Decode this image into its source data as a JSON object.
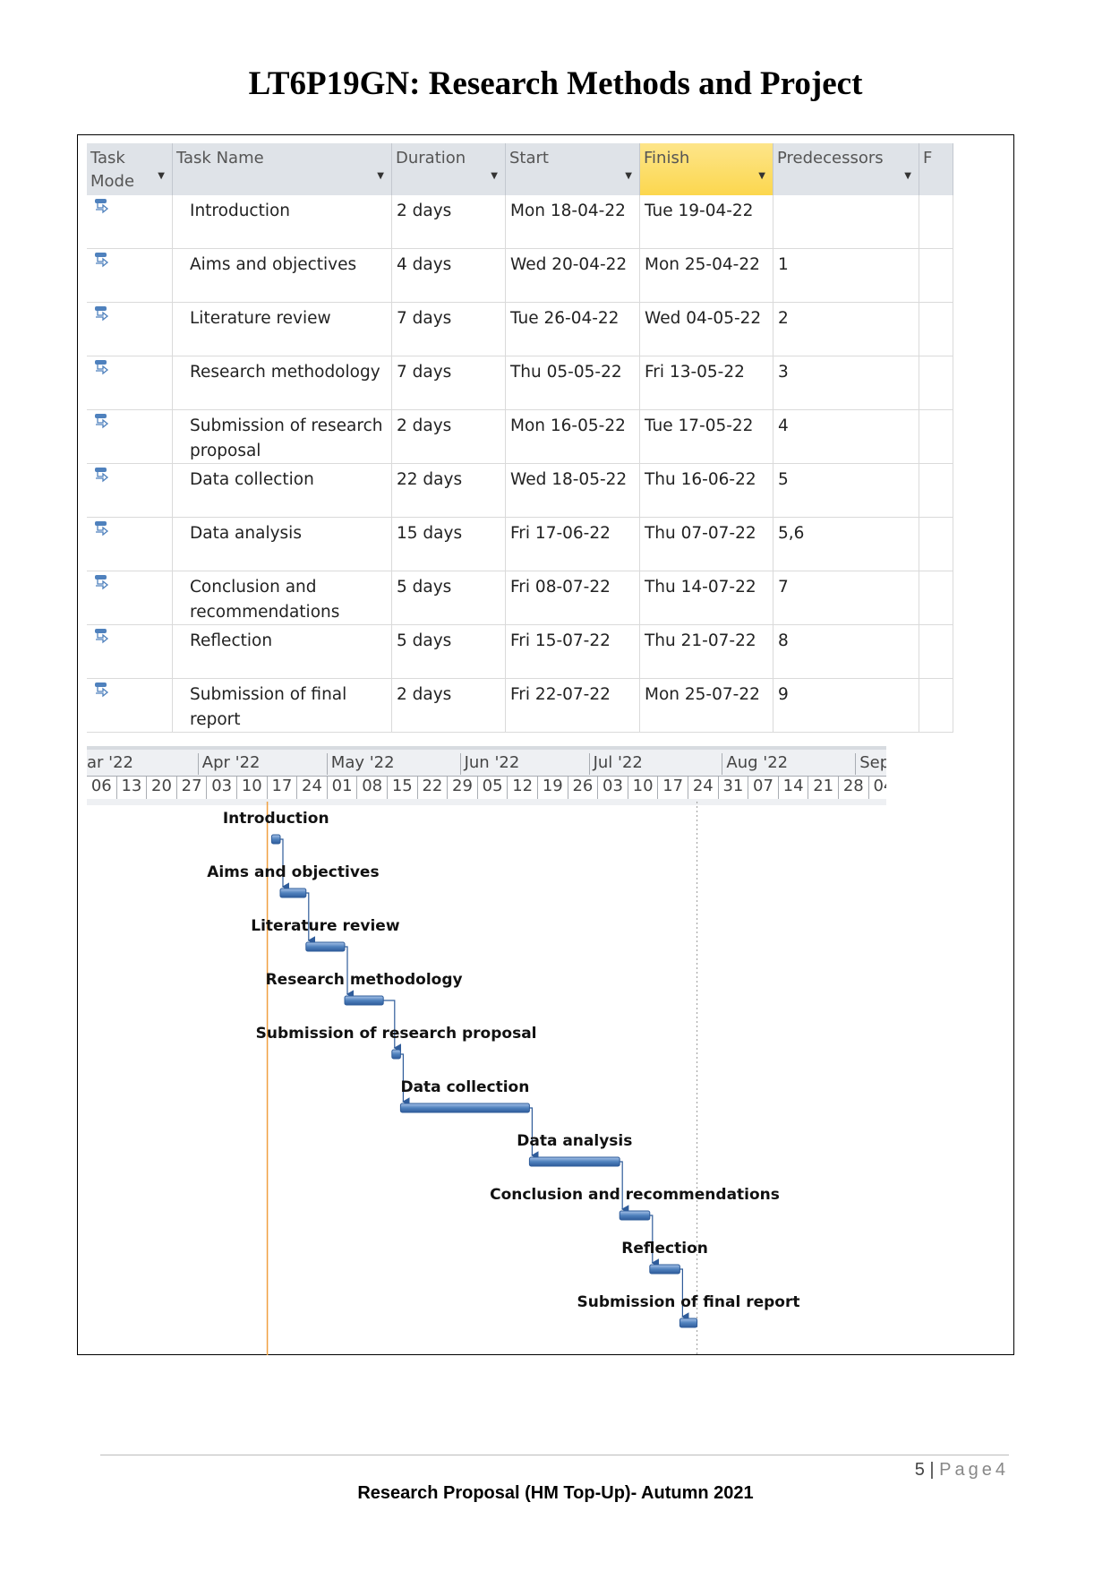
{
  "document_title": "LT6P19GN: Research Methods and Project",
  "table": {
    "headers": {
      "task_mode": "Task Mode",
      "task_name": "Task Name",
      "duration": "Duration",
      "start": "Start",
      "finish": "Finish",
      "predecessors": "Predecessors",
      "extra": "F"
    },
    "finish_header_color": "#fcd74e",
    "rows": [
      {
        "mode_icon": "auto-scheduled-task-icon",
        "name": "Introduction",
        "duration": "2 days",
        "start": "Mon 18-04-22",
        "finish": "Tue 19-04-22",
        "predecessors": ""
      },
      {
        "mode_icon": "auto-scheduled-task-icon",
        "name": "Aims and objectives",
        "duration": "4 days",
        "start": "Wed 20-04-22",
        "finish": "Mon 25-04-22",
        "predecessors": "1"
      },
      {
        "mode_icon": "auto-scheduled-task-icon",
        "name": "Literature review",
        "duration": "7 days",
        "start": "Tue 26-04-22",
        "finish": "Wed 04-05-22",
        "predecessors": "2"
      },
      {
        "mode_icon": "auto-scheduled-task-icon",
        "name": "Research methodology",
        "duration": "7 days",
        "start": "Thu 05-05-22",
        "finish": "Fri 13-05-22",
        "predecessors": "3"
      },
      {
        "mode_icon": "auto-scheduled-task-icon",
        "name": "Submission of research proposal",
        "duration": "2 days",
        "start": "Mon 16-05-22",
        "finish": "Tue 17-05-22",
        "predecessors": "4"
      },
      {
        "mode_icon": "auto-scheduled-task-icon",
        "name": "Data collection",
        "duration": "22 days",
        "start": "Wed 18-05-22",
        "finish": "Thu 16-06-22",
        "predecessors": "5"
      },
      {
        "mode_icon": "auto-scheduled-task-icon",
        "name": "Data analysis",
        "duration": "15 days",
        "start": "Fri 17-06-22",
        "finish": "Thu 07-07-22",
        "predecessors": "5,6"
      },
      {
        "mode_icon": "auto-scheduled-task-icon",
        "name": "Conclusion and recommendations",
        "duration": "5 days",
        "start": "Fri 08-07-22",
        "finish": "Thu 14-07-22",
        "predecessors": "7"
      },
      {
        "mode_icon": "auto-scheduled-task-icon",
        "name": "Reflection",
        "duration": "5 days",
        "start": "Fri 15-07-22",
        "finish": "Thu 21-07-22",
        "predecessors": "8"
      },
      {
        "mode_icon": "auto-scheduled-task-icon",
        "name": "Submission of final report",
        "duration": "2 days",
        "start": "Fri 22-07-22",
        "finish": "Mon 25-07-22",
        "predecessors": "9"
      }
    ]
  },
  "timeline": {
    "months": [
      "ar '22",
      "Apr '22",
      "May '22",
      "Jun '22",
      "Jul '22",
      "Aug '22",
      "Sep"
    ],
    "weeks": [
      "06",
      "13",
      "20",
      "27",
      "03",
      "10",
      "17",
      "24",
      "01",
      "08",
      "15",
      "22",
      "29",
      "05",
      "12",
      "19",
      "26",
      "03",
      "10",
      "17",
      "24",
      "31",
      "07",
      "14",
      "21",
      "28",
      "04"
    ]
  },
  "chart_data": {
    "type": "gantt",
    "tasks": [
      {
        "label": "Introduction",
        "start": "2022-04-18",
        "finish": "2022-04-19"
      },
      {
        "label": "Aims and objectives",
        "start": "2022-04-20",
        "finish": "2022-04-25"
      },
      {
        "label": "Literature review",
        "start": "2022-04-26",
        "finish": "2022-05-04"
      },
      {
        "label": "Research methodology",
        "start": "2022-05-05",
        "finish": "2022-05-13"
      },
      {
        "label": "Submission of research proposal",
        "start": "2022-05-16",
        "finish": "2022-05-17"
      },
      {
        "label": "Data collection",
        "start": "2022-05-18",
        "finish": "2022-06-16"
      },
      {
        "label": "Data analysis",
        "start": "2022-06-17",
        "finish": "2022-07-07"
      },
      {
        "label": "Conclusion and recommendations",
        "start": "2022-07-08",
        "finish": "2022-07-14"
      },
      {
        "label": "Reflection",
        "start": "2022-07-15",
        "finish": "2022-07-21"
      },
      {
        "label": "Submission of final report",
        "start": "2022-07-22",
        "finish": "2022-07-25"
      }
    ],
    "x_range": [
      "2022-03-06",
      "2022-09-04"
    ],
    "today_line": "2022-04-17",
    "dotted_line": "2022-07-26",
    "bar_color": "#4f81bd",
    "today_color": "#f0a040"
  },
  "footer": {
    "page_number": "5",
    "separator": "|",
    "page_word": "Page",
    "page_suffix": "4",
    "text": "Research Proposal (HM Top-Up)- Autumn 2021"
  }
}
